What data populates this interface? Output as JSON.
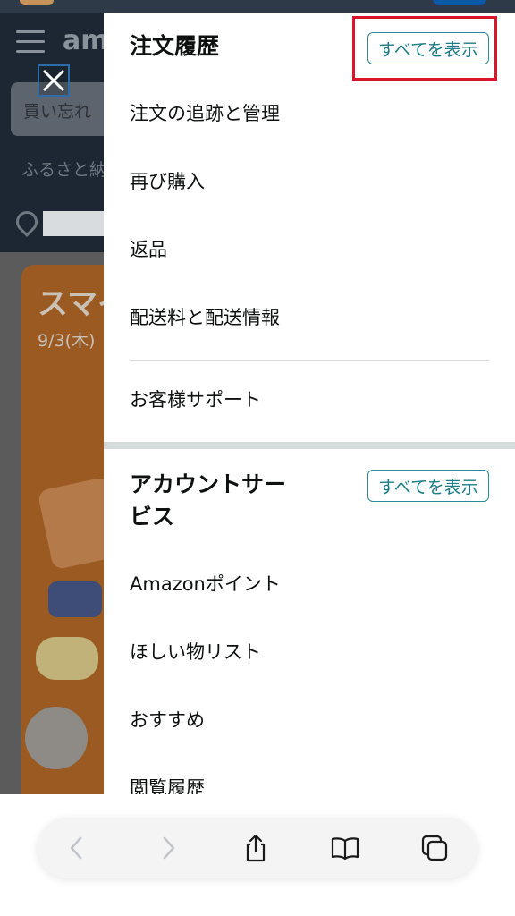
{
  "background": {
    "search_placeholder": "買い忘れ",
    "furusato_text": "ふるさと納",
    "banner_title": "スマイ",
    "banner_date": "9/3(木)",
    "logo_text": "am"
  },
  "menu": {
    "order_history": {
      "title": "注文履歴",
      "show_all": "すべてを表示",
      "items": [
        "注文の追跡と管理",
        "再び購入",
        "返品",
        "配送料と配送情報"
      ],
      "support": "お客様サポート"
    },
    "account_services": {
      "title_line1": "アカウントサー",
      "title_line2": "ビス",
      "show_all": "すべてを表示",
      "items": [
        "Amazonポイント",
        "ほしい物リスト",
        "おすすめ",
        "閲覧履歴"
      ]
    }
  },
  "toolbar": {
    "icons": [
      "back-icon",
      "forward-icon",
      "share-icon",
      "bookmarks-icon",
      "tabs-icon"
    ]
  },
  "colors": {
    "highlight": "#d8152a",
    "accent_teal": "#1c7d86",
    "header_dark": "#1d2733"
  }
}
